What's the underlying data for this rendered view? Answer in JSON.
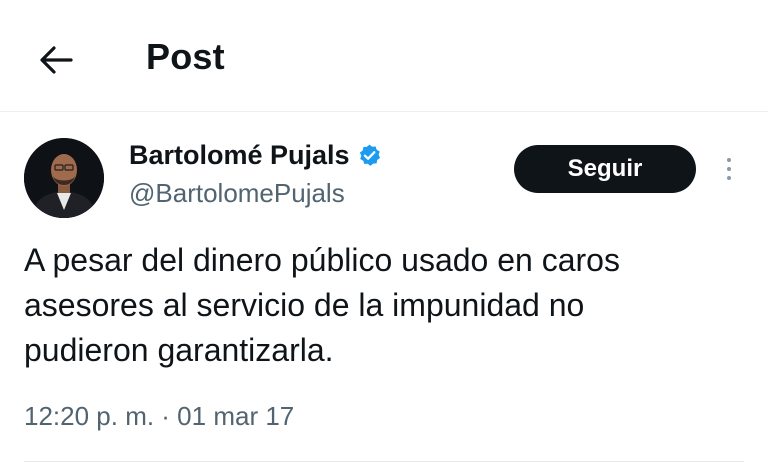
{
  "header": {
    "back_icon": "arrow-left-icon",
    "title": "Post"
  },
  "post": {
    "author": {
      "name": "Bartolomé Pujals",
      "handle": "@BartolomePujals",
      "verified": true,
      "verified_icon": "verified-badge-icon",
      "verified_color": "#1d9bf0"
    },
    "follow_label": "Seguir",
    "more_icon": "more-vertical-icon",
    "text_lines": [
      "A pesar del dinero público usado en caros",
      "asesores al servicio de la impunidad no",
      "pudieron garantizarla."
    ],
    "timestamp": "12:20 p. m. · 01 mar 17"
  },
  "colors": {
    "text_primary": "#0f1419",
    "text_secondary": "#536471",
    "button_bg": "#0f1419",
    "button_text": "#ffffff"
  }
}
